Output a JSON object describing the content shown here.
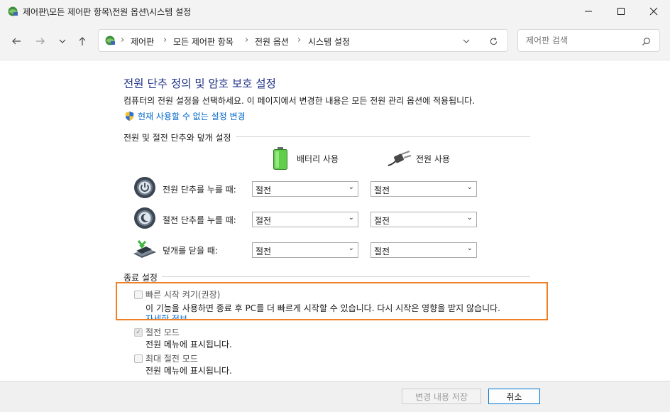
{
  "window": {
    "title": "제어판\\모든 제어판 항목\\전원 옵션\\시스템 설정",
    "minimize": "—",
    "maximize": "☐",
    "close": "✕"
  },
  "nav": {
    "back": "←",
    "forward": "→",
    "recent": "⌄",
    "up": "↑",
    "breadcrumbs": [
      "제어판",
      "모든 제어판 항목",
      "전원 옵션",
      "시스템 설정"
    ],
    "dropdown": "⌄",
    "refresh": "↻",
    "search_placeholder": "제어판 검색",
    "search_value": ""
  },
  "main": {
    "heading": "전원 단추 정의 및 암호 보호 설정",
    "description": "컴퓨터의 전원 설정을 선택하세요. 이 페이지에서 변경한 내용은 모든 전원 관리 옵션에 적용됩니다.",
    "change_link": "현재 사용할 수 없는 설정 변경",
    "section_buttons": "전원 및 절전 단추와 덮개 설정",
    "col_battery": "배터리 사용",
    "col_plugged": "전원 사용",
    "rows": [
      {
        "label": "전원 단추를 누를 때:",
        "battery": "절전",
        "plugged": "절전"
      },
      {
        "label": "절전 단추를 누를 때:",
        "battery": "절전",
        "plugged": "절전"
      },
      {
        "label": "덮개를 닫을 때:",
        "battery": "절전",
        "plugged": "절전"
      }
    ],
    "section_shutdown": "종료 설정",
    "options": [
      {
        "label": "빠른 시작 켜기(권장)",
        "sub": "이 기능을 사용하면 종료 후 PC를 더 빠르게 시작할 수 있습니다. 다시 시작은 영향을 받지 않습니다.",
        "link": "자세한 정보",
        "checked": false
      },
      {
        "label": "절전 모드",
        "sub": "전원 메뉴에 표시됩니다.",
        "checked": true
      },
      {
        "label": "최대 절전 모드",
        "sub": "전원 메뉴에 표시됩니다.",
        "checked": false
      }
    ],
    "highlight_color": "#f07f24"
  },
  "footer": {
    "save": "변경 내용 저장",
    "cancel": "취소"
  },
  "colors": {
    "heading": "#1e3287",
    "link": "#0066cc",
    "accent": "#0078d4"
  }
}
